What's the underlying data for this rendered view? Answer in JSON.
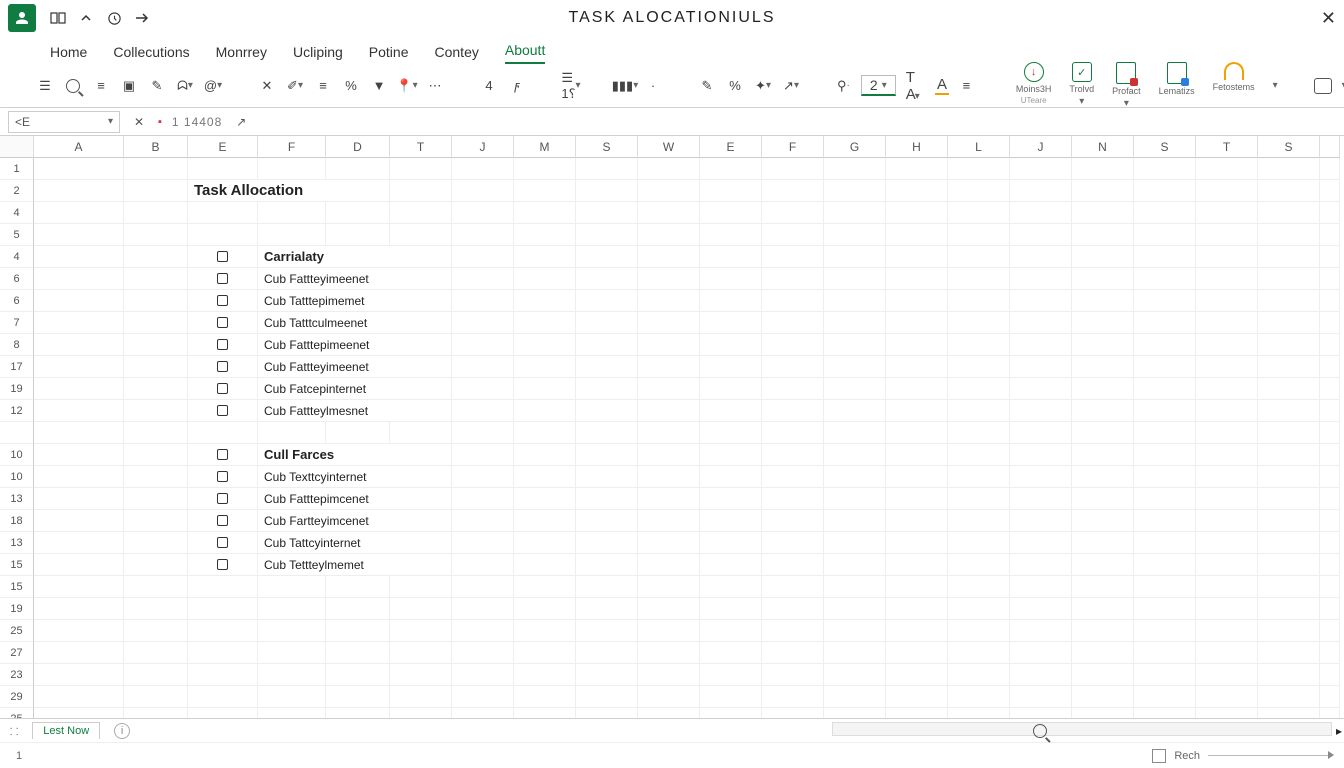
{
  "title": "TASK ALOCATIONIULS",
  "quick": [
    "layout",
    "chevron-up",
    "clock",
    "arrow-right"
  ],
  "tabs": [
    "Home",
    "Collecutions",
    "Monrrey",
    "Ucliping",
    "Potine",
    "Contey",
    "Aboutt"
  ],
  "active_tab": 6,
  "ribbon": {
    "font_size": "2",
    "big_labels": [
      "Moins3H",
      "Trolvd",
      "Profact",
      "Lematizs",
      "Fetostems"
    ],
    "sublabel": "UTeare"
  },
  "formula_bar": {
    "namebox": "<E",
    "value": "1 14408"
  },
  "columns": [
    "A",
    "B",
    "E",
    "F",
    "D",
    "T",
    "J",
    "M",
    "S",
    "W",
    "E",
    "F",
    "G",
    "H",
    "L",
    "J",
    "N",
    "S",
    "T",
    "S",
    ""
  ],
  "col_classes": [
    "wA",
    "wB",
    "wE",
    "wF",
    "wD",
    "wT",
    "wJ",
    "wM",
    "wS",
    "wW",
    "wE2",
    "wF2",
    "wG",
    "wH",
    "wL",
    "wJ2",
    "wN",
    "wS2",
    "wT2",
    "wS3",
    "wLast"
  ],
  "row_headers": [
    "1",
    "2",
    "4",
    "5",
    "4",
    "6",
    "6",
    "7",
    "8",
    "17",
    "19",
    "12",
    "",
    "10",
    "10",
    "13",
    "18",
    "13",
    "15",
    "15",
    "19",
    "25",
    "27",
    "23",
    "29",
    "25"
  ],
  "sheet_title": "Task Allocation",
  "section1_header": "Carrialaty",
  "section1_items": [
    "Cub Fattteyimeenet",
    "Cub Tatttepimemet",
    "Cub Tatttculmeenet",
    "Cub Fatttepimeenet",
    "Cub Fattteyimeenet",
    "Cub Fatcepinternet",
    "Cub Fattteylmesnet"
  ],
  "section2_header": "Cull Farces",
  "section2_items": [
    "Cub Texttcyinternet",
    "Cub Fatttepimcenet",
    "Cub Fartteyimcenet",
    "Cub Tattcyinternet",
    "Cub Tettteylmemet"
  ],
  "sheet_tab": "Lest Now",
  "status_left": "1",
  "status_zoom": "Rech"
}
